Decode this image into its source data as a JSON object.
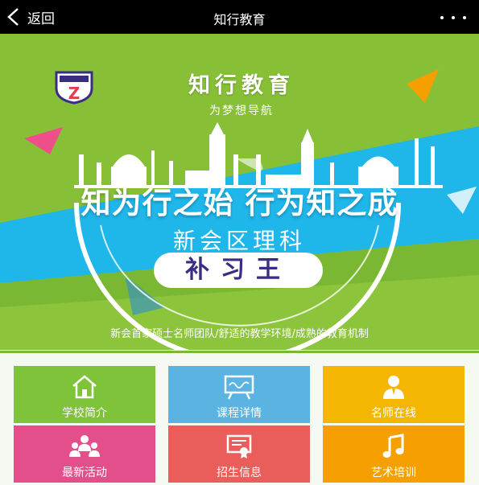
{
  "topbar": {
    "back_label": "返回",
    "title": "知行教育"
  },
  "banner": {
    "brand_title": "知行教育",
    "brand_subtitle": "为梦想导航",
    "slogan": "知为行之始 行为知之成",
    "district": "新会区理科",
    "badge": "补习王",
    "tagline": "新会首家硕士名师团队/舒适的教学环境/成熟的教育机制",
    "logo": {
      "name": "zhixing-logo-icon",
      "color": "#3a2d84",
      "accent": "#e63a4f"
    },
    "colors": {
      "green": "#8cc43c",
      "blue": "#1fb6ea"
    }
  },
  "menu": {
    "items": [
      {
        "label": "学校简介",
        "icon": "house-icon",
        "color": "#7fc33a"
      },
      {
        "label": "课程详情",
        "icon": "chalkboard-icon",
        "color": "#5ab3e0"
      },
      {
        "label": "名师在线",
        "icon": "teacher-icon",
        "color": "#f4b600"
      },
      {
        "label": "最新活动",
        "icon": "group-icon",
        "color": "#e24f8a"
      },
      {
        "label": "招生信息",
        "icon": "certificate-icon",
        "color": "#e95d5a"
      },
      {
        "label": "艺术培训",
        "icon": "music-note-icon",
        "color": "#f5a000"
      }
    ]
  }
}
